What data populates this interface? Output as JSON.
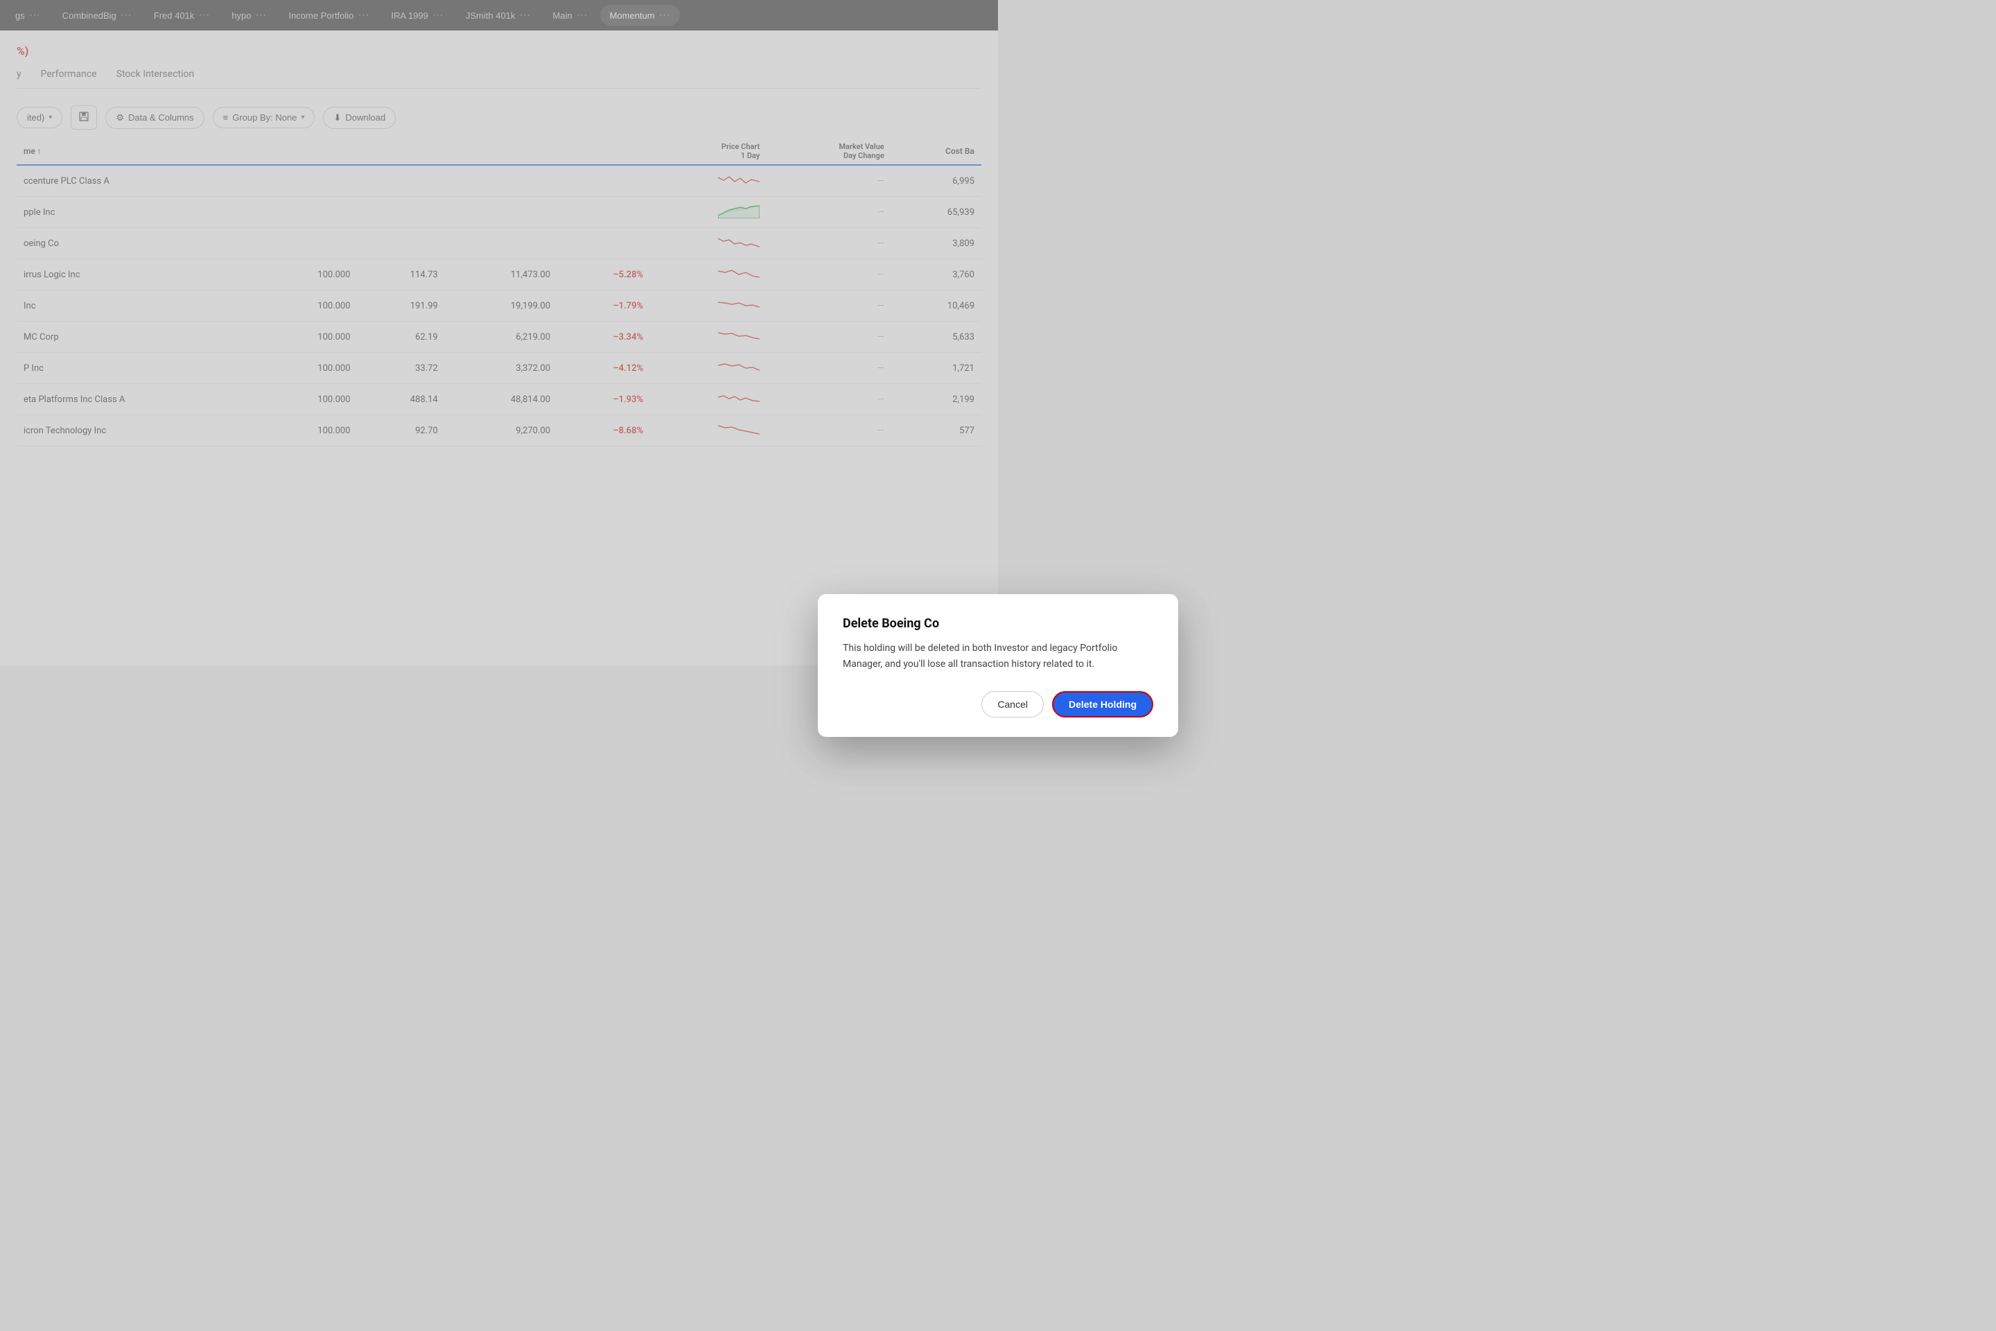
{
  "tabs": [
    {
      "label": "gs",
      "active": false
    },
    {
      "label": "CombinedBig",
      "active": false
    },
    {
      "label": "Fred 401k",
      "active": false
    },
    {
      "label": "hypo",
      "active": false
    },
    {
      "label": "Income Portfolio",
      "active": false
    },
    {
      "label": "IRA 1999",
      "active": false
    },
    {
      "label": "JSmith 401k",
      "active": false
    },
    {
      "label": "Main",
      "active": false
    },
    {
      "label": "Momentum",
      "active": true
    }
  ],
  "header": {
    "red_label": "%)",
    "subnav": [
      {
        "label": "y",
        "active": false
      },
      {
        "label": "Performance",
        "active": false
      },
      {
        "label": "Stock Intersection",
        "active": false
      }
    ]
  },
  "toolbar": {
    "filter_label": "ited)",
    "data_columns_label": "Data & Columns",
    "group_by_label": "Group By: None",
    "download_label": "Download"
  },
  "table": {
    "columns": [
      {
        "label": "me ↑",
        "align": "left"
      },
      {
        "label": "",
        "align": "right"
      },
      {
        "label": "",
        "align": "right"
      },
      {
        "label": "",
        "align": "right"
      },
      {
        "label": "",
        "align": "right"
      },
      {
        "label": "Price Chart\n1 Day",
        "align": "right"
      },
      {
        "label": "Market Value\nDay Change",
        "align": "right"
      },
      {
        "label": "Cost Ba",
        "align": "right"
      }
    ],
    "rows": [
      {
        "name": "ccenture PLC Class A",
        "qty": "",
        "price": "",
        "value": "",
        "change": "",
        "cost": "6,995"
      },
      {
        "name": "pple Inc",
        "qty": "",
        "price": "",
        "value": "",
        "change": "",
        "cost": "65,939"
      },
      {
        "name": "oeing Co",
        "qty": "",
        "price": "",
        "value": "",
        "change": "",
        "cost": "3,809"
      },
      {
        "name": "irrus Logic Inc",
        "qty": "100.000",
        "price": "114.73",
        "value": "11,473.00",
        "change": "-5.28%",
        "cost": "3,760"
      },
      {
        "name": " Inc",
        "qty": "100.000",
        "price": "191.99",
        "value": "19,199.00",
        "change": "-1.79%",
        "cost": "10,469"
      },
      {
        "name": "MC Corp",
        "qty": "100.000",
        "price": "62.19",
        "value": "6,219.00",
        "change": "-3.34%",
        "cost": "5,633"
      },
      {
        "name": "P Inc",
        "qty": "100.000",
        "price": "33.72",
        "value": "3,372.00",
        "change": "-4.12%",
        "cost": "1,721"
      },
      {
        "name": "eta Platforms Inc Class A",
        "qty": "100.000",
        "price": "488.14",
        "value": "48,814.00",
        "change": "-1.93%",
        "cost": "2,199"
      },
      {
        "name": "icron Technology Inc",
        "qty": "100.000",
        "price": "92.70",
        "value": "9,270.00",
        "change": "-8.68%",
        "cost": "577"
      }
    ]
  },
  "dialog": {
    "title": "Delete Boeing Co",
    "body": "This holding will be deleted in both Investor and legacy Portfolio Manager, and you'll lose all transaction history related to it.",
    "cancel_label": "Cancel",
    "delete_label": "Delete Holding"
  }
}
